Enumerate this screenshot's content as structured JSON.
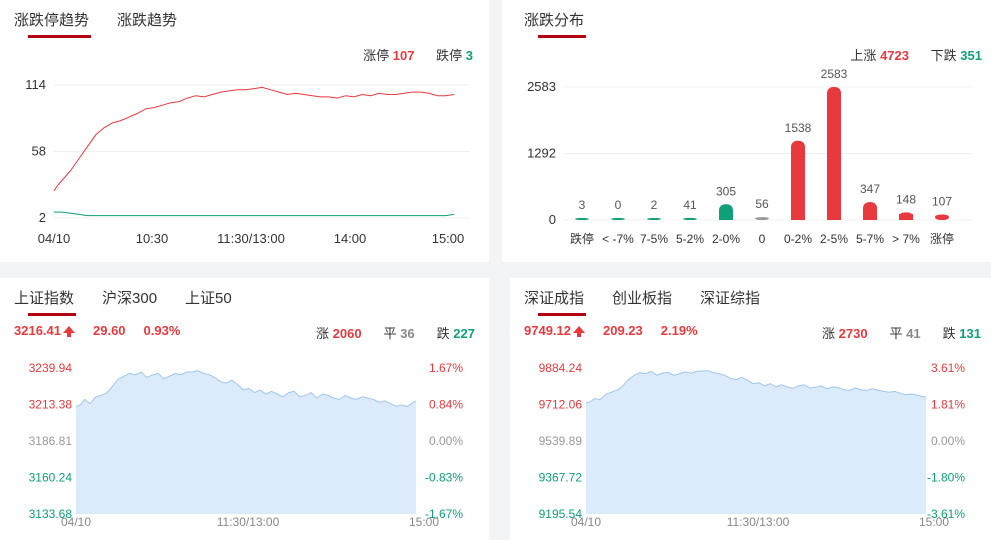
{
  "colors": {
    "up": "#e8393e",
    "down": "#0f9f7a",
    "flat": "#999999",
    "fill": "#dcebfb",
    "line": "#9fc6ee",
    "accent": "#b40010"
  },
  "trend": {
    "tabs": [
      "涨跌停趋势",
      "涨跌趋势"
    ],
    "limit_up_label": "涨停",
    "limit_up": "107",
    "limit_down_label": "跌停",
    "limit_down": "3"
  },
  "dist": {
    "tabs": [
      "涨跌分布"
    ],
    "up_label": "上涨",
    "up": "4723",
    "down_label": "下跌",
    "down": "351"
  },
  "sh": {
    "tabs": [
      "上证指数",
      "沪深300",
      "上证50"
    ],
    "price": "3216.41",
    "change": "29.60",
    "pct": "0.93%",
    "up_label": "涨",
    "up": "2060",
    "flat_label": "平",
    "flat": "36",
    "down_label": "跌",
    "down": "227"
  },
  "sz": {
    "tabs": [
      "深证成指",
      "创业板指",
      "深证综指"
    ],
    "price": "9749.12",
    "change": "209.23",
    "pct": "2.19%",
    "up_label": "涨",
    "up": "2730",
    "flat_label": "平",
    "flat": "41",
    "down_label": "跌",
    "down": "131"
  },
  "chart_data": [
    {
      "type": "line",
      "x_ticks": [
        "04/10",
        "10:30",
        "11:30/13:00",
        "14:00",
        "15:00"
      ],
      "y_ticks": [
        "114",
        "58",
        "2"
      ],
      "ylim": [
        2,
        114
      ],
      "series": [
        {
          "color": "#e8393e",
          "x": [
            0,
            2,
            5,
            10,
            15,
            20,
            25,
            30,
            35,
            40,
            45,
            50,
            55,
            60,
            65,
            70,
            75,
            80,
            85,
            90,
            95,
            100,
            105,
            110,
            115,
            120,
            125,
            130,
            135,
            140,
            145,
            150,
            155,
            160,
            165,
            170,
            175,
            180,
            185,
            190,
            195,
            200,
            205,
            210,
            215,
            220,
            225,
            230,
            235,
            240
          ],
          "values": [
            25,
            29,
            34,
            42,
            52,
            62,
            72,
            78,
            82,
            84,
            87,
            90,
            94,
            95,
            97,
            99,
            100,
            103,
            105,
            104,
            106,
            108,
            109,
            110,
            110,
            111,
            112,
            110,
            108,
            106,
            107,
            106,
            105,
            104,
            104,
            103,
            105,
            104,
            106,
            105,
            107,
            106,
            106,
            107,
            108,
            108,
            107,
            105,
            105,
            106
          ]
        },
        {
          "color": "#0f9f7a",
          "x": [
            0,
            5,
            10,
            15,
            20,
            30,
            40,
            60,
            80,
            100,
            120,
            140,
            160,
            180,
            200,
            220,
            235,
            240
          ],
          "values": [
            7,
            7,
            6,
            5,
            4,
            4,
            4,
            4,
            4,
            4,
            4,
            4,
            4,
            4,
            4,
            4,
            4,
            5
          ]
        }
      ]
    },
    {
      "type": "bar",
      "y_ticks": [
        "2583",
        "1292",
        "0"
      ],
      "ylim": [
        0,
        2583
      ],
      "categories": [
        "跌停",
        "< -7%",
        "7-5%",
        "5-2%",
        "2-0%",
        "0",
        "0-2%",
        "2-5%",
        "5-7%",
        "> 7%",
        "涨停"
      ],
      "values": [
        3,
        0,
        2,
        41,
        305,
        56,
        1538,
        2583,
        347,
        148,
        107
      ],
      "labels": [
        "3",
        "0",
        "2",
        "41",
        "305",
        "56",
        "1538",
        "2583",
        "347",
        "148",
        "107"
      ],
      "colors": [
        "#0f9f7a",
        "#0f9f7a",
        "#0f9f7a",
        "#0f9f7a",
        "#0f9f7a",
        "#999999",
        "#e8393e",
        "#e8393e",
        "#e8393e",
        "#e8393e",
        "#e8393e"
      ]
    },
    {
      "type": "area",
      "x_ticks": [
        "04/10",
        "11:30/13:00",
        "15:00"
      ],
      "y_ticks": [
        "3239.94",
        "3213.38",
        "3186.81",
        "3160.24",
        "3133.68"
      ],
      "pct_ticks": [
        "1.67%",
        "0.84%",
        "0.00%",
        "-0.83%",
        "-1.67%"
      ],
      "ylim": [
        3133.68,
        3239.94
      ],
      "x": [
        0,
        3,
        6,
        10,
        14,
        18,
        22,
        26,
        30,
        34,
        38,
        42,
        46,
        50,
        54,
        58,
        62,
        66,
        70,
        74,
        78,
        82,
        86,
        90,
        94,
        98,
        102,
        106,
        110,
        114,
        118,
        122,
        126,
        130,
        134,
        138,
        142,
        146,
        150,
        154,
        158,
        162,
        166,
        170,
        174,
        178,
        182,
        186,
        190,
        194,
        198,
        202,
        206,
        210,
        214,
        218,
        222,
        226,
        230,
        234,
        238,
        240
      ],
      "values": [
        3212,
        3213,
        3217,
        3214,
        3219,
        3220,
        3222,
        3227,
        3232,
        3234,
        3236,
        3235,
        3237,
        3233,
        3235,
        3236,
        3232,
        3234,
        3236,
        3235,
        3237,
        3237,
        3238,
        3236,
        3235,
        3233,
        3230,
        3229,
        3231,
        3228,
        3224,
        3225,
        3222,
        3224,
        3221,
        3223,
        3221,
        3219,
        3222,
        3223,
        3219,
        3220,
        3222,
        3218,
        3221,
        3220,
        3218,
        3217,
        3220,
        3218,
        3217,
        3219,
        3218,
        3217,
        3215,
        3216,
        3214,
        3212,
        3213,
        3212,
        3215,
        3216
      ]
    },
    {
      "type": "area",
      "x_ticks": [
        "04/10",
        "11:30/13:00",
        "15:00"
      ],
      "y_ticks": [
        "9884.24",
        "9712.06",
        "9539.89",
        "9367.72",
        "9195.54"
      ],
      "pct_ticks": [
        "3.61%",
        "1.81%",
        "0.00%",
        "-1.80%",
        "-3.61%"
      ],
      "ylim": [
        9195.54,
        9884.24
      ],
      "x": [
        0,
        3,
        6,
        10,
        14,
        18,
        22,
        26,
        30,
        34,
        38,
        42,
        46,
        50,
        54,
        58,
        62,
        66,
        70,
        74,
        78,
        82,
        86,
        90,
        94,
        98,
        102,
        106,
        110,
        114,
        118,
        122,
        126,
        130,
        134,
        138,
        142,
        146,
        150,
        154,
        158,
        162,
        166,
        170,
        174,
        178,
        182,
        186,
        190,
        194,
        198,
        202,
        206,
        210,
        214,
        218,
        222,
        226,
        230,
        234,
        238,
        240
      ],
      "values": [
        9720,
        9725,
        9740,
        9735,
        9760,
        9770,
        9780,
        9800,
        9830,
        9850,
        9862,
        9858,
        9868,
        9850,
        9860,
        9864,
        9850,
        9858,
        9866,
        9860,
        9868,
        9870,
        9872,
        9862,
        9858,
        9850,
        9835,
        9830,
        9840,
        9826,
        9810,
        9815,
        9800,
        9810,
        9795,
        9805,
        9795,
        9788,
        9800,
        9805,
        9790,
        9793,
        9800,
        9786,
        9795,
        9792,
        9782,
        9778,
        9790,
        9782,
        9778,
        9786,
        9780,
        9775,
        9770,
        9774,
        9765,
        9758,
        9762,
        9756,
        9748,
        9749
      ]
    }
  ]
}
